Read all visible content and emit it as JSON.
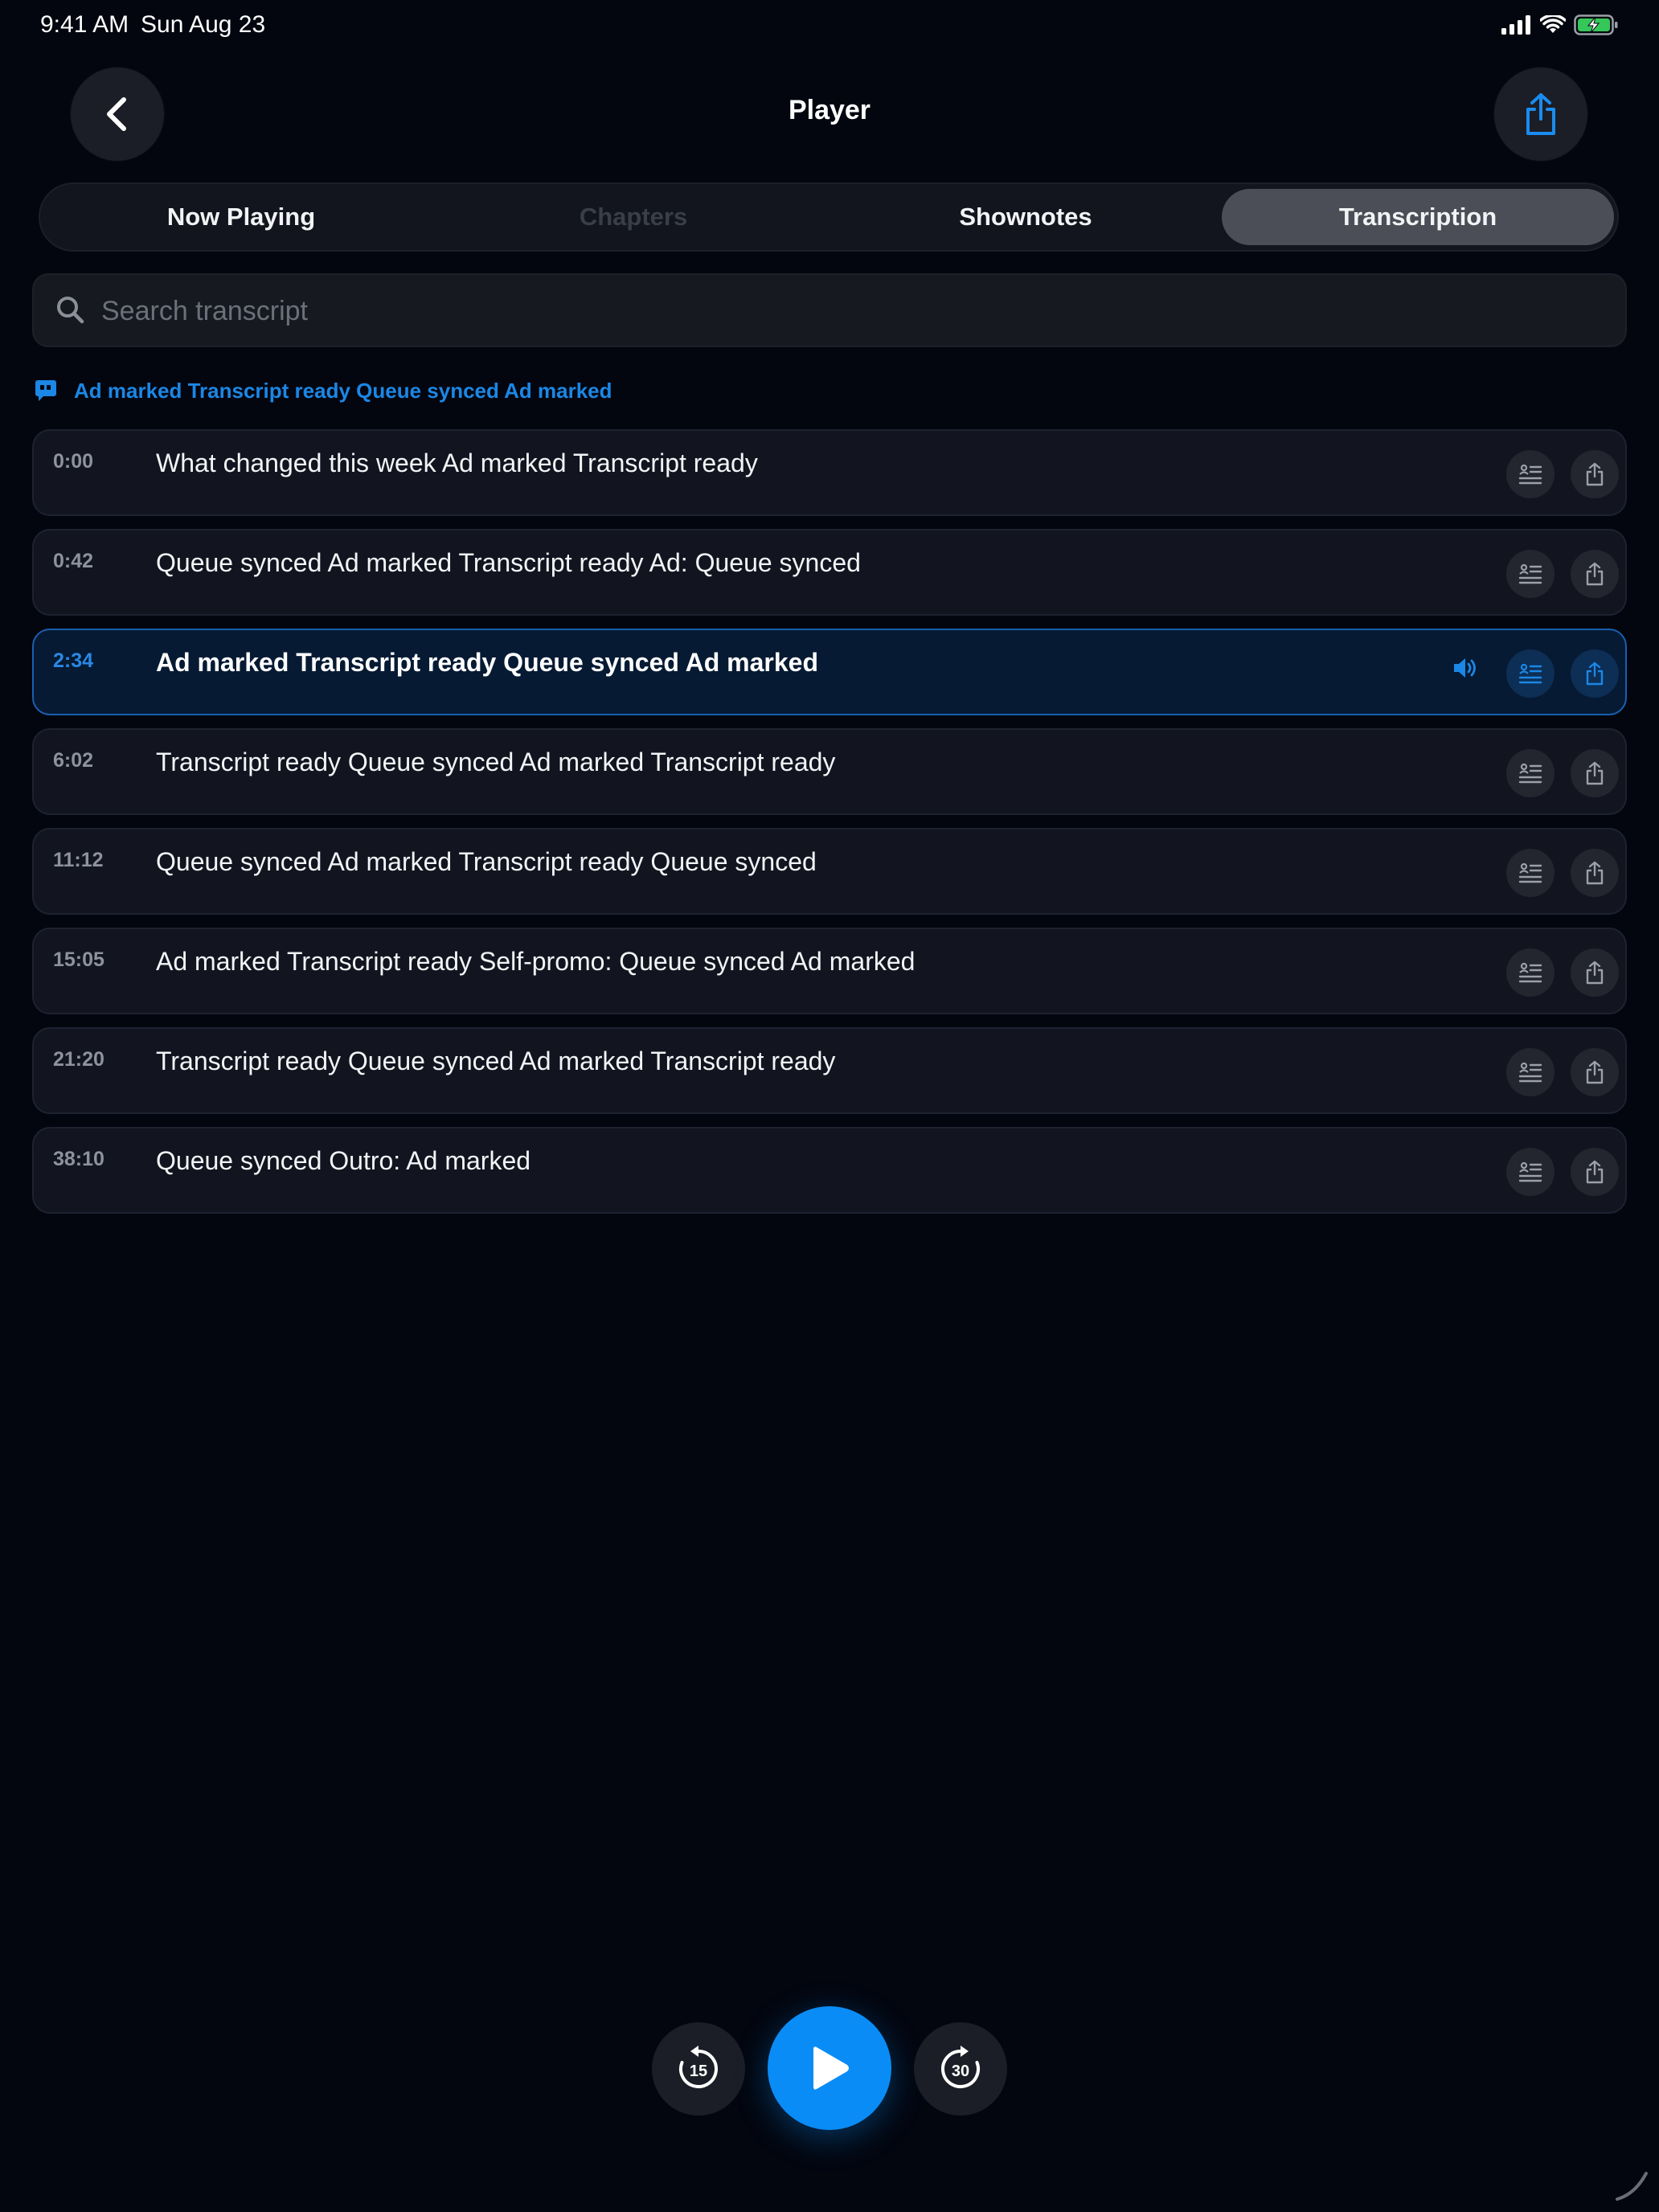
{
  "status_bar": {
    "time": "9:41 AM",
    "date": "Sun Aug 23"
  },
  "header": {
    "title": "Player"
  },
  "tabs": [
    {
      "label": "Now Playing",
      "state": "normal"
    },
    {
      "label": "Chapters",
      "state": "disabled"
    },
    {
      "label": "Shownotes",
      "state": "normal"
    },
    {
      "label": "Transcription",
      "state": "selected"
    }
  ],
  "search": {
    "placeholder": "Search transcript",
    "value": ""
  },
  "banner": {
    "text": "Ad marked Transcript ready Queue synced Ad marked",
    "icon": "quote-bubble-icon"
  },
  "transcript": [
    {
      "time": "0:00",
      "text": "What changed this week Ad marked Transcript ready"
    },
    {
      "time": "0:42",
      "text": "Queue synced Ad marked Transcript ready Ad: Queue synced"
    },
    {
      "time": "2:34",
      "text": "Ad marked Transcript ready Queue synced Ad marked",
      "active": true
    },
    {
      "time": "6:02",
      "text": "Transcript ready Queue synced Ad marked Transcript ready"
    },
    {
      "time": "11:12",
      "text": "Queue synced Ad marked Transcript ready Queue synced"
    },
    {
      "time": "15:05",
      "text": "Ad marked Transcript ready Self-promo: Queue synced Ad marked"
    },
    {
      "time": "21:20",
      "text": "Transcript ready Queue synced Ad marked Transcript ready"
    },
    {
      "time": "38:10",
      "text": "Queue synced Outro: Ad marked"
    }
  ],
  "player": {
    "skip_back_seconds": "15",
    "skip_forward_seconds": "30"
  },
  "colors": {
    "accent": "#0a8cf6",
    "background": "#03060f",
    "active_row": "#061a33"
  }
}
